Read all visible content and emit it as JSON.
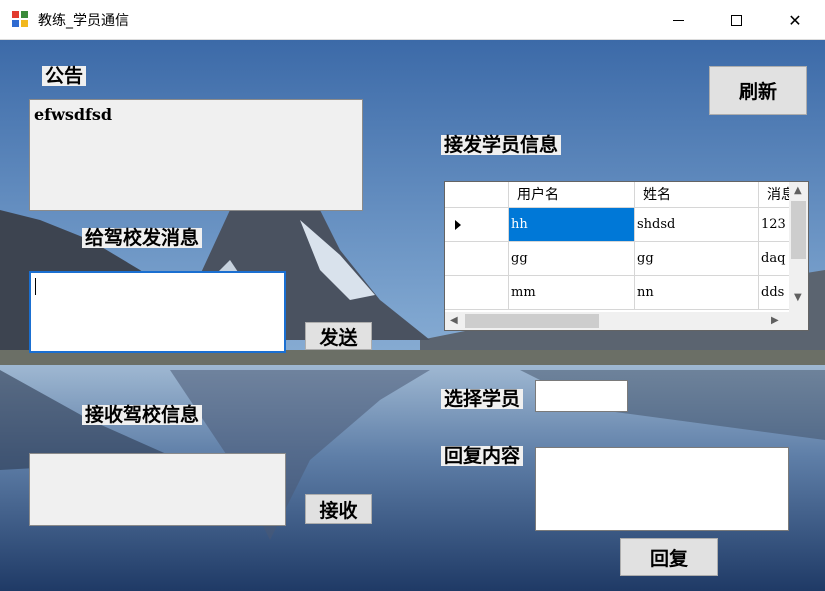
{
  "window": {
    "title": "教练_学员通信",
    "minimize_glyph": "",
    "close_glyph": "✕"
  },
  "labels": {
    "announcement": "公告",
    "send_to_school": "给驾校发消息",
    "receive_school": "接收驾校信息",
    "send_student_info": "接发学员信息",
    "select_student": "选择学员",
    "reply_content": "回复内容"
  },
  "announcement_text": "efwsdfsd",
  "send_message_value": "",
  "received_school_message": "",
  "selected_student_value": "",
  "reply_content_value": "",
  "buttons": {
    "refresh": "刷新",
    "send": "发送",
    "receive": "接收",
    "reply": "回复"
  },
  "grid": {
    "columns": [
      "用户名",
      "姓名",
      "消息"
    ],
    "rows": [
      [
        "hh",
        "shdsd",
        "123"
      ],
      [
        "gg",
        "gg",
        "daq"
      ],
      [
        "mm",
        "nn",
        "dds"
      ]
    ],
    "selected_row": 0
  },
  "icons": {
    "app": "app-window-icon",
    "minimize": "minimize-icon",
    "maximize": "maximize-icon",
    "close": "close-icon",
    "current_row": "row-pointer-icon"
  }
}
